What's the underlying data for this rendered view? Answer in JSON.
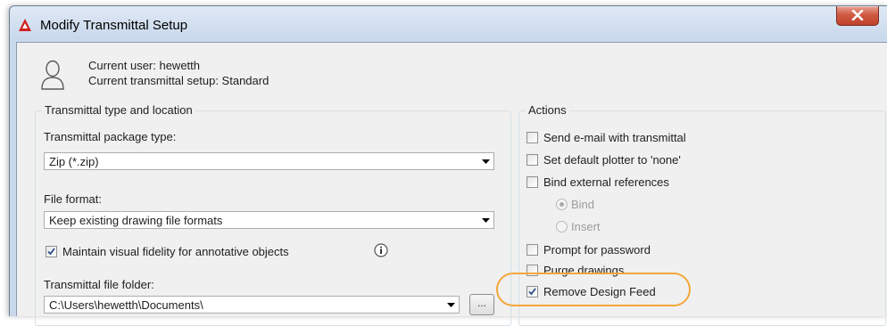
{
  "window": {
    "title": "Modify Transmittal Setup"
  },
  "user_info": {
    "current_user": "Current user: hewetth",
    "current_setup": "Current transmittal setup: Standard"
  },
  "transmittal_group": {
    "title": "Transmittal type and location",
    "package_type_label": "Transmittal package type:",
    "package_type_value": "Zip (*.zip)",
    "file_format_label": "File format:",
    "file_format_value": "Keep existing drawing file formats",
    "maintain_fidelity_label": "Maintain visual fidelity for annotative objects",
    "maintain_fidelity_checked": true,
    "folder_label": "Transmittal file folder:",
    "folder_value": "C:\\Users\\hewetth\\Documents\\",
    "browse_label": "..."
  },
  "actions_group": {
    "title": "Actions",
    "send_email": {
      "label": "Send e-mail with transmittal",
      "checked": false
    },
    "default_plotter": {
      "label": "Set default plotter to 'none'",
      "checked": false
    },
    "bind_xrefs": {
      "label": "Bind external references",
      "checked": false
    },
    "bind_option": {
      "label": "Bind",
      "selected": true,
      "enabled": false
    },
    "insert_option": {
      "label": "Insert",
      "selected": false,
      "enabled": false
    },
    "prompt_password": {
      "label": "Prompt for password",
      "checked": false
    },
    "purge_drawings": {
      "label": "Purge drawings",
      "checked": false
    },
    "remove_design_feed": {
      "label": "Remove Design Feed",
      "checked": true
    }
  },
  "colors": {
    "highlight": "#f2a73b",
    "close_button": "#c9503a",
    "app_icon": "#d11f1f"
  },
  "icons": {
    "app": "autocad-logo-icon",
    "user": "user-icon",
    "info": "info-icon",
    "close": "close-icon",
    "dropdown": "chevron-down-icon",
    "check": "checkmark-icon"
  }
}
